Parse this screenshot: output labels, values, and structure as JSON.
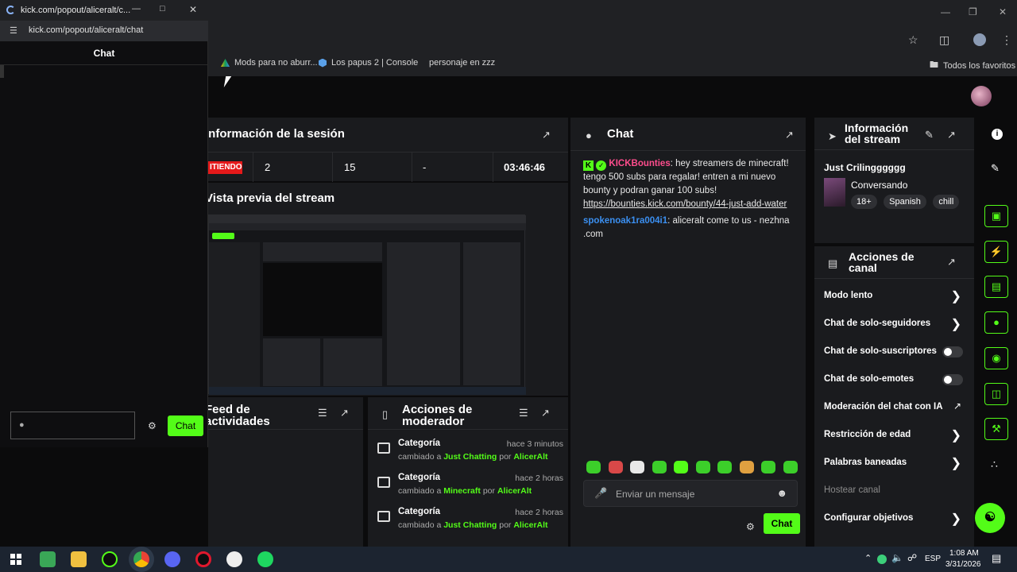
{
  "browser": {
    "address_right_icons": [
      "star-icon",
      "extension-icon",
      "profile-icon",
      "kebab-menu-icon"
    ],
    "bookmarks": [
      {
        "label": "Mods para no aburr...",
        "icon": "drive-icon"
      },
      {
        "label": "Los papus 2 | Console",
        "icon": "cube-icon"
      },
      {
        "label": "personaje en zzz",
        "icon": ""
      },
      {
        "label": "Todos los favoritos",
        "icon": "folder-icon"
      }
    ]
  },
  "popout": {
    "title_bar": "kick.com/popout/aliceralt/c...",
    "url": "kick.com/popout/aliceralt/chat",
    "header": "Chat",
    "send_label": "Chat"
  },
  "session": {
    "title": "Información de la sesión",
    "status": "EMITIENDO",
    "status_visible": "ITIENDO",
    "stats": [
      "2",
      "15",
      "-",
      "03:46:46"
    ]
  },
  "preview": {
    "title": "Vista previa del stream"
  },
  "activity": {
    "title": "Feed de actividades"
  },
  "moderator": {
    "title": "Acciones de moderador",
    "items": [
      {
        "head": "Categoría",
        "time": "hace 3 minutos",
        "pre": "cambiado a",
        "value": "Just Chatting",
        "by": "por",
        "user": "AlicerAlt"
      },
      {
        "head": "Categoría",
        "time": "hace 2 horas",
        "pre": "cambiado a",
        "value": "Minecraft",
        "by": "por",
        "user": "AlicerAlt"
      },
      {
        "head": "Categoría",
        "time": "hace 2 horas",
        "pre": "cambiado a",
        "value": "Just Chatting",
        "by": "por",
        "user": "AlicerAlt"
      }
    ]
  },
  "chat": {
    "title": "Chat",
    "messages": [
      {
        "user": "KICKBounties",
        "text": ": hey streamers de minecraft! tengo 500 subs para regalar! entren a mi nuevo bounty y podran ganar 100 subs!",
        "link": "https://bounties.kick.com/bounty/44-just-add-water"
      },
      {
        "user": "spokenoak1ra004i1",
        "text": ": aliceralt come to us - nezhna .com"
      }
    ],
    "input_placeholder": "Enviar un mensaje",
    "send_label": "Chat"
  },
  "stream_info": {
    "title": "Información del stream",
    "stream_title": "Just Crilingggggg",
    "category": "Conversando",
    "tags": [
      "18+",
      "Spanish",
      "chill"
    ]
  },
  "channel_actions": {
    "title": "Acciones de canal",
    "items": [
      {
        "label": "Modo lento",
        "control": "chevron"
      },
      {
        "label": "Chat de solo-seguidores",
        "control": "chevron"
      },
      {
        "label": "Chat de solo-suscriptores",
        "control": "toggle"
      },
      {
        "label": "Chat de solo-emotes",
        "control": "toggle"
      },
      {
        "label": "Moderación del chat con IA",
        "control": "external"
      },
      {
        "label": "Restricción de edad",
        "control": "chevron"
      },
      {
        "label": "Palabras baneadas",
        "control": "chevron"
      },
      {
        "label": "Hostear canal",
        "control": "none"
      },
      {
        "label": "Configurar objetivos",
        "control": "chevron"
      }
    ]
  },
  "taskbar": {
    "time": "1:08 AM",
    "date": "3/31/2026",
    "lang": "ESP"
  },
  "colors": {
    "accent": "#53fc18",
    "live": "#e5191a",
    "link": "#53fc18",
    "panel": "#1a1b1e"
  }
}
